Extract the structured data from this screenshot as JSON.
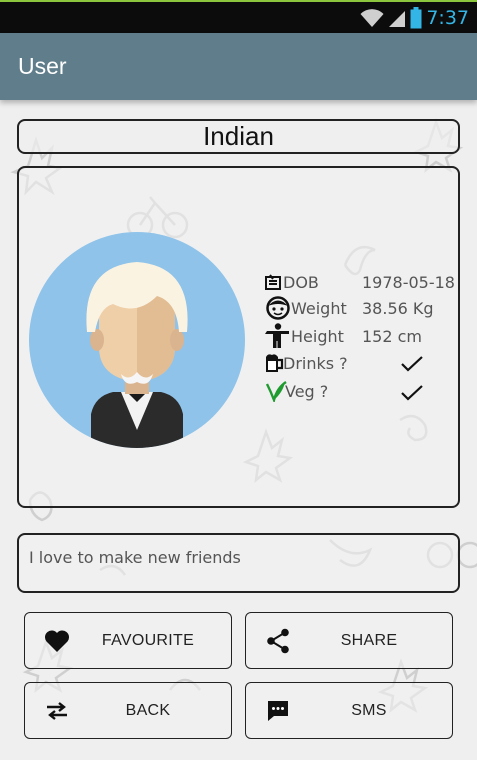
{
  "status_bar": {
    "time": "7:37"
  },
  "app_bar": {
    "title": "User"
  },
  "profile": {
    "name": "Indian",
    "fields": [
      {
        "icon": "id-card-icon",
        "label": "DOB",
        "value": "1978-05-18"
      },
      {
        "icon": "face-icon",
        "label": "Weight",
        "value": "38.56 Kg"
      },
      {
        "icon": "person-icon",
        "label": "Height",
        "value": "152 cm"
      },
      {
        "icon": "beer-mug-icon",
        "label": "Drinks ?",
        "value": "checked"
      },
      {
        "icon": "leaf-icon",
        "label": "Veg ?",
        "value": "checked"
      }
    ],
    "bio": "I love to make new friends"
  },
  "actions": {
    "favourite": "FAVOURITE",
    "share": "SHARE",
    "back": "BACK",
    "sms": "SMS"
  },
  "colors": {
    "app_bar": "#607d8b",
    "status_bar": "#0c0c0c",
    "clock": "#33b5e5",
    "avatar_bg": "#8fc3ea",
    "veg_leaf": "#1f9b2f"
  }
}
